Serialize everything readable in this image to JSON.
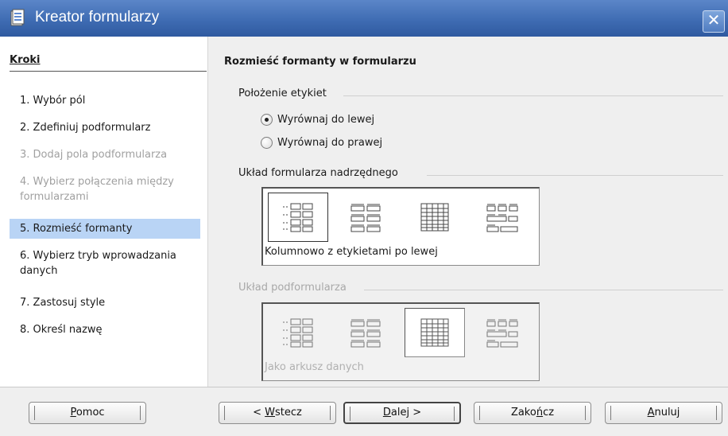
{
  "window": {
    "title": "Kreator formularzy",
    "close_glyph": "✕"
  },
  "steps": {
    "header": "Kroki",
    "items": [
      {
        "label": "1. Wybór pól",
        "state": "enabled"
      },
      {
        "label": "2. Zdefiniuj podformularz",
        "state": "enabled"
      },
      {
        "label": "3. Dodaj pola podformularza",
        "state": "disabled"
      },
      {
        "label": "4. Wybierz połączenia między formularzami",
        "state": "disabled"
      },
      {
        "label": "5. Rozmieść formanty",
        "state": "selected"
      },
      {
        "label": "6. Wybierz tryb wprowadzania danych",
        "state": "enabled"
      },
      {
        "label": "7. Zastosuj style",
        "state": "enabled"
      },
      {
        "label": "8. Określ nazwę",
        "state": "enabled"
      }
    ]
  },
  "main": {
    "heading": "Rozmieść formanty w formularzu",
    "label_position": {
      "title": "Położenie etykiet",
      "options": [
        {
          "label": "Wyrównaj do lewej",
          "checked": true
        },
        {
          "label": "Wyrównaj do prawej",
          "checked": false
        }
      ]
    },
    "main_layout": {
      "title": "Układ formularza nadrzędnego",
      "options": [
        "columnar-left-labels-icon",
        "columnar-top-labels-icon",
        "datasheet-icon",
        "block-top-labels-icon"
      ],
      "selected": 0,
      "caption": "Kolumnowo z etykietami po lewej"
    },
    "sub_layout": {
      "title": "Układ podformularza",
      "disabled": true,
      "options": [
        "columnar-left-labels-icon",
        "columnar-top-labels-icon",
        "datasheet-icon",
        "block-top-labels-icon"
      ],
      "selected": 2,
      "caption": "Jako arkusz danych"
    }
  },
  "buttons": {
    "help": {
      "prefix": "",
      "accel": "P",
      "suffix": "omoc"
    },
    "back": {
      "prefix": "< ",
      "accel": "W",
      "suffix": "stecz"
    },
    "next": {
      "prefix": "",
      "accel": "D",
      "suffix": "alej >"
    },
    "finish": {
      "prefix": "Zako",
      "accel": "ń",
      "suffix": "cz"
    },
    "cancel": {
      "prefix": "",
      "accel": "A",
      "suffix": "nuluj"
    }
  },
  "colors": {
    "titlebar": "#3f6cb3",
    "selection": "#b9d4f5",
    "disabled_text": "#a0a0a0"
  }
}
